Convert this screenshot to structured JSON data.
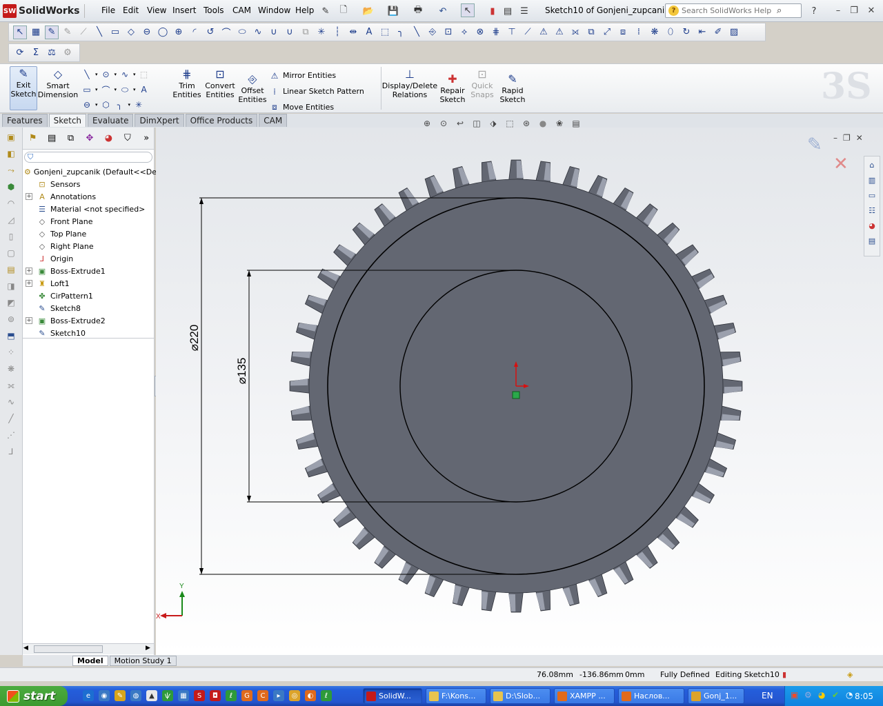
{
  "app": {
    "name": "SolidWorks",
    "logo_badge": "SW",
    "document_title": "Sketch10 of Gonjeni_zupcanik.S..."
  },
  "menu": [
    "File",
    "Edit",
    "View",
    "Insert",
    "Tools",
    "CAM",
    "Window",
    "Help"
  ],
  "help_search": {
    "placeholder": "Search SolidWorks Help"
  },
  "command_manager": {
    "exit_sketch": "Exit Sketch",
    "smart_dimension": "Smart Dimension",
    "trim_entities": "Trim Entities",
    "convert_entities": "Convert Entities",
    "offset_entities": "Offset Entities",
    "mirror_entities": "Mirror Entities",
    "linear_sketch_pattern": "Linear Sketch Pattern",
    "move_entities": "Move Entities",
    "display_delete_relations": "Display/Delete Relations",
    "repair_sketch": "Repair Sketch",
    "quick_snaps": "Quick Snaps",
    "rapid_sketch": "Rapid Sketch"
  },
  "tabs": [
    "Features",
    "Sketch",
    "Evaluate",
    "DimXpert",
    "Office Products",
    "CAM"
  ],
  "active_tab": "Sketch",
  "feature_tree": {
    "root": "Gonjeni_zupcanik  (Default<<Defa",
    "items": [
      {
        "label": "Sensors",
        "expandable": false,
        "icon": "sensor-icon"
      },
      {
        "label": "Annotations",
        "expandable": true,
        "icon": "annotation-icon"
      },
      {
        "label": "Material <not specified>",
        "expandable": false,
        "icon": "material-icon"
      },
      {
        "label": "Front Plane",
        "expandable": false,
        "icon": "plane-icon"
      },
      {
        "label": "Top Plane",
        "expandable": false,
        "icon": "plane-icon"
      },
      {
        "label": "Right Plane",
        "expandable": false,
        "icon": "plane-icon"
      },
      {
        "label": "Origin",
        "expandable": false,
        "icon": "origin-icon"
      },
      {
        "label": "Boss-Extrude1",
        "expandable": true,
        "icon": "extrude-icon"
      },
      {
        "label": "Loft1",
        "expandable": true,
        "icon": "loft-icon"
      },
      {
        "label": "CirPattern1",
        "expandable": false,
        "icon": "circular-pattern-icon"
      },
      {
        "label": "Sketch8",
        "expandable": false,
        "icon": "sketch-icon"
      },
      {
        "label": "Boss-Extrude2",
        "expandable": true,
        "icon": "extrude-icon"
      },
      {
        "label": "Sketch10",
        "expandable": false,
        "icon": "sketch-icon"
      }
    ]
  },
  "drawing": {
    "dim_outer": "⌀220",
    "dim_inner": "⌀135",
    "tooth_count": 48,
    "axis_x": "X",
    "axis_y": "Y"
  },
  "bottom_tabs": [
    "Model",
    "Motion Study 1"
  ],
  "status": {
    "x": "76.08mm",
    "y": "-136.86mm",
    "z": "0mm",
    "state": "Fully Defined",
    "editing": "Editing Sketch10"
  },
  "taskbar": {
    "start": "start",
    "tasks": [
      "SolidW...",
      "F:\\Kons...",
      "D:\\Slob...",
      "XAMPP ...",
      "Наслов...",
      "Gonj_1..."
    ],
    "active_task": 0,
    "language": "EN",
    "clock": "8:05"
  },
  "colors": {
    "gear_body": "#636772",
    "gear_tooth_face": "#9ba0ad",
    "sketch_line": "#000000",
    "origin_red": "#d81010"
  }
}
